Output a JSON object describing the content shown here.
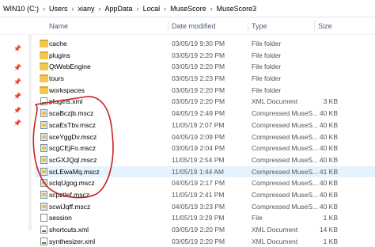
{
  "breadcrumb": {
    "items": [
      "WIN10 (C:)",
      "Users",
      "xiany",
      "AppData",
      "Local",
      "MuseScore",
      "MuseScore3"
    ],
    "separator": "›"
  },
  "columns": {
    "name": "Name",
    "date": "Date modified",
    "type": "Type",
    "size": "Size"
  },
  "files": [
    {
      "name": "cache",
      "date": "03/05/19 9:30 PM",
      "type": "File folder",
      "size": "",
      "icon": "folder-icon"
    },
    {
      "name": "plugins",
      "date": "03/05/19 2:20 PM",
      "type": "File folder",
      "size": "",
      "icon": "folder-icon"
    },
    {
      "name": "QtWebEngine",
      "date": "03/05/19 2:20 PM",
      "type": "File folder",
      "size": "",
      "icon": "folder-icon"
    },
    {
      "name": "tours",
      "date": "03/05/19 2:23 PM",
      "type": "File folder",
      "size": "",
      "icon": "folder-icon"
    },
    {
      "name": "workspaces",
      "date": "03/05/19 2:20 PM",
      "type": "File folder",
      "size": "",
      "icon": "folder-icon"
    },
    {
      "name": "plugins.xml",
      "date": "03/05/19 2:20 PM",
      "type": "XML Document",
      "size": "3 KB",
      "icon": "xml-file-icon"
    },
    {
      "name": "scaBczjb.mscz",
      "date": "04/05/19 2:49 PM",
      "type": "Compressed MuseS...",
      "size": "40 KB",
      "icon": "mscz-file-icon"
    },
    {
      "name": "scaEsTbv.mscz",
      "date": "11/05/19 2:07 PM",
      "type": "Compressed MuseS...",
      "size": "40 KB",
      "icon": "mscz-file-icon"
    },
    {
      "name": "sceYggDv.mscz",
      "date": "04/05/19 2:09 PM",
      "type": "Compressed MuseS...",
      "size": "40 KB",
      "icon": "mscz-file-icon"
    },
    {
      "name": "scgCEjFo.mscz",
      "date": "03/05/19 2:04 PM",
      "type": "Compressed MuseS...",
      "size": "40 KB",
      "icon": "mscz-file-icon"
    },
    {
      "name": "scGXJQql.mscz",
      "date": "11/05/19 2:54 PM",
      "type": "Compressed MuseS...",
      "size": "40 KB",
      "icon": "mscz-file-icon"
    },
    {
      "name": "scLEwaMq.mscz",
      "date": "11/05/19 1:44 AM",
      "type": "Compressed MuseS...",
      "size": "41 KB",
      "icon": "mscz-file-icon",
      "selected": true
    },
    {
      "name": "sclqUgog.mscz",
      "date": "04/05/19 2:17 PM",
      "type": "Compressed MuseS...",
      "size": "40 KB",
      "icon": "mscz-file-icon"
    },
    {
      "name": "scpztlef.mscz",
      "date": "11/05/19 2:41 PM",
      "type": "Compressed MuseS...",
      "size": "40 KB",
      "icon": "mscz-file-icon"
    },
    {
      "name": "scwiJqff.mscz",
      "date": "04/05/19 3:23 PM",
      "type": "Compressed MuseS...",
      "size": "40 KB",
      "icon": "mscz-file-icon"
    },
    {
      "name": "session",
      "date": "11/05/19 3:29 PM",
      "type": "File",
      "size": "1 KB",
      "icon": "file-icon"
    },
    {
      "name": "shortcuts.xml",
      "date": "03/05/19 2:20 PM",
      "type": "XML Document",
      "size": "14 KB",
      "icon": "xml-file-icon"
    },
    {
      "name": "synthesizer.xml",
      "date": "03/05/19 2:20 PM",
      "type": "XML Document",
      "size": "1 KB",
      "icon": "xml-file-icon"
    }
  ],
  "colors": {
    "selected_row": "#e5f3ff",
    "header_text": "#4c607a",
    "annotation": "#cc1f1f",
    "folder": "#f3c74e"
  }
}
